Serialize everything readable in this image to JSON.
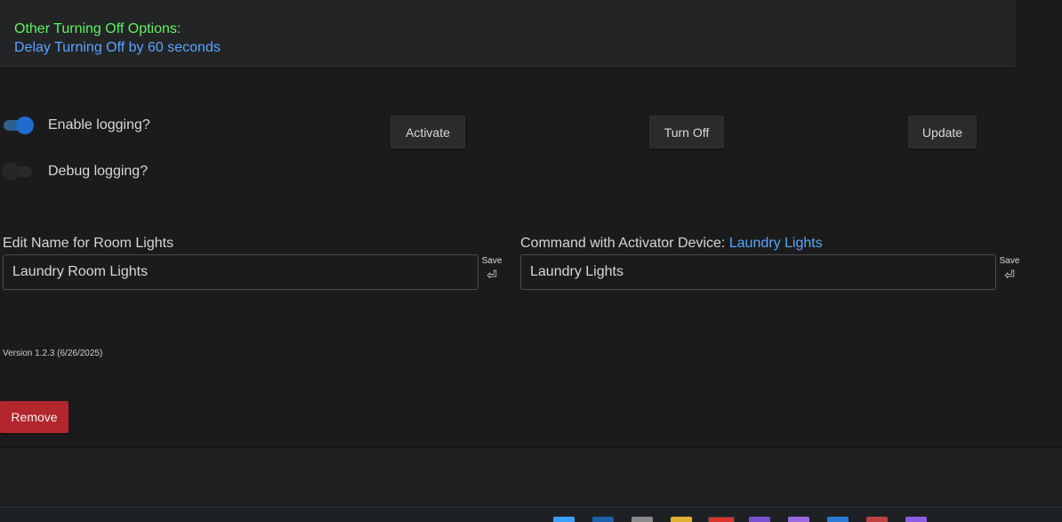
{
  "options": {
    "heading": "Other Turning Off Options:",
    "delay_link": "Delay Turning Off by 60 seconds"
  },
  "toggles": {
    "enable_logging": {
      "label": "Enable logging?",
      "on": true
    },
    "debug_logging": {
      "label": "Debug logging?",
      "on": false
    }
  },
  "actions": {
    "activate": "Activate",
    "turn_off": "Turn Off",
    "update": "Update"
  },
  "edit_name": {
    "label": "Edit Name for Room Lights",
    "value": "Laundry  Room Lights",
    "save_label": "Save",
    "save_icon": "return-icon"
  },
  "command": {
    "label": "Command with Activator Device: ",
    "device_link": "Laundry Lights",
    "value": "Laundry Lights",
    "save_label": "Save",
    "save_icon": "return-icon"
  },
  "version": "Version 1.2.3 (6/26/2025)",
  "remove_label": "Remove",
  "colors": {
    "heading_green": "#5ff25f",
    "link_blue": "#5aa5ff",
    "toggle_on": "#1f6bd0",
    "remove_red": "#b3262d"
  },
  "taskbar": {
    "icons": [
      "windows-start-icon",
      "mail-icon",
      "calculator-icon",
      "file-explorer-icon",
      "browser-icon",
      "visual-studio-icon",
      "app-icon",
      "store-icon",
      "app-icon-2",
      "app-icon-3"
    ]
  }
}
